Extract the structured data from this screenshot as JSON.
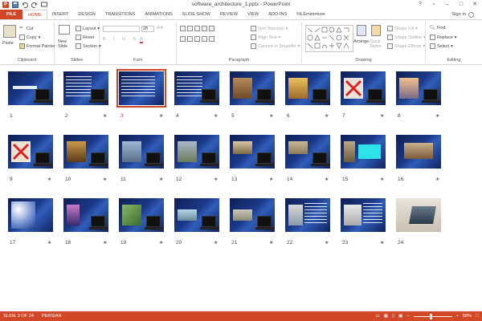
{
  "window": {
    "title": "software_architecture_1.pptx - PowerPoint",
    "signin": "Sign in"
  },
  "tabs": [
    {
      "label": "FILE"
    },
    {
      "label": "HOME"
    },
    {
      "label": "INSERT"
    },
    {
      "label": "DESIGN"
    },
    {
      "label": "TRANSITIONS"
    },
    {
      "label": "ANIMATIONS"
    },
    {
      "label": "SLIDE SHOW"
    },
    {
      "label": "REVIEW"
    },
    {
      "label": "VIEW"
    },
    {
      "label": "ADD-INS"
    },
    {
      "label": "FILEminimizer"
    }
  ],
  "ribbon": {
    "clipboard": {
      "label": "Clipboard",
      "paste": "Paste",
      "cut": "Cut",
      "copy": "Copy",
      "format_painter": "Format Painter"
    },
    "slides": {
      "label": "Slides",
      "new_slide": "New Slide",
      "layout": "Layout",
      "reset": "Reset",
      "section": "Section"
    },
    "font": {
      "label": "Font",
      "size": "28"
    },
    "paragraph": {
      "label": "Paragraph",
      "text_direction": "Text Direction",
      "align_text": "Align Text",
      "convert_smartart": "Convert to SmartArt"
    },
    "drawing": {
      "label": "Drawing",
      "arrange": "Arrange",
      "quick_styles": "Quick Styles",
      "shape_fill": "Shape Fill",
      "shape_outline": "Shape Outline",
      "shape_effects": "Shape Effects"
    },
    "editing": {
      "label": "Editing",
      "find": "Find",
      "replace": "Replace",
      "select": "Select"
    }
  },
  "slides": [
    {
      "num": "1"
    },
    {
      "num": "2"
    },
    {
      "num": "3"
    },
    {
      "num": "4"
    },
    {
      "num": "5"
    },
    {
      "num": "6"
    },
    {
      "num": "7"
    },
    {
      "num": "8"
    },
    {
      "num": "9"
    },
    {
      "num": "10"
    },
    {
      "num": "11"
    },
    {
      "num": "12"
    },
    {
      "num": "13"
    },
    {
      "num": "14"
    },
    {
      "num": "15"
    },
    {
      "num": "16"
    },
    {
      "num": "17"
    },
    {
      "num": "18"
    },
    {
      "num": "19"
    },
    {
      "num": "20"
    },
    {
      "num": "21"
    },
    {
      "num": "22"
    },
    {
      "num": "23"
    },
    {
      "num": "24"
    }
  ],
  "selected_slide": 3,
  "status": {
    "slide_info": "SLIDE 3 OF 24",
    "language": "PERSIAN",
    "zoom": "58%"
  },
  "colors": {
    "accent": "#d24726"
  }
}
